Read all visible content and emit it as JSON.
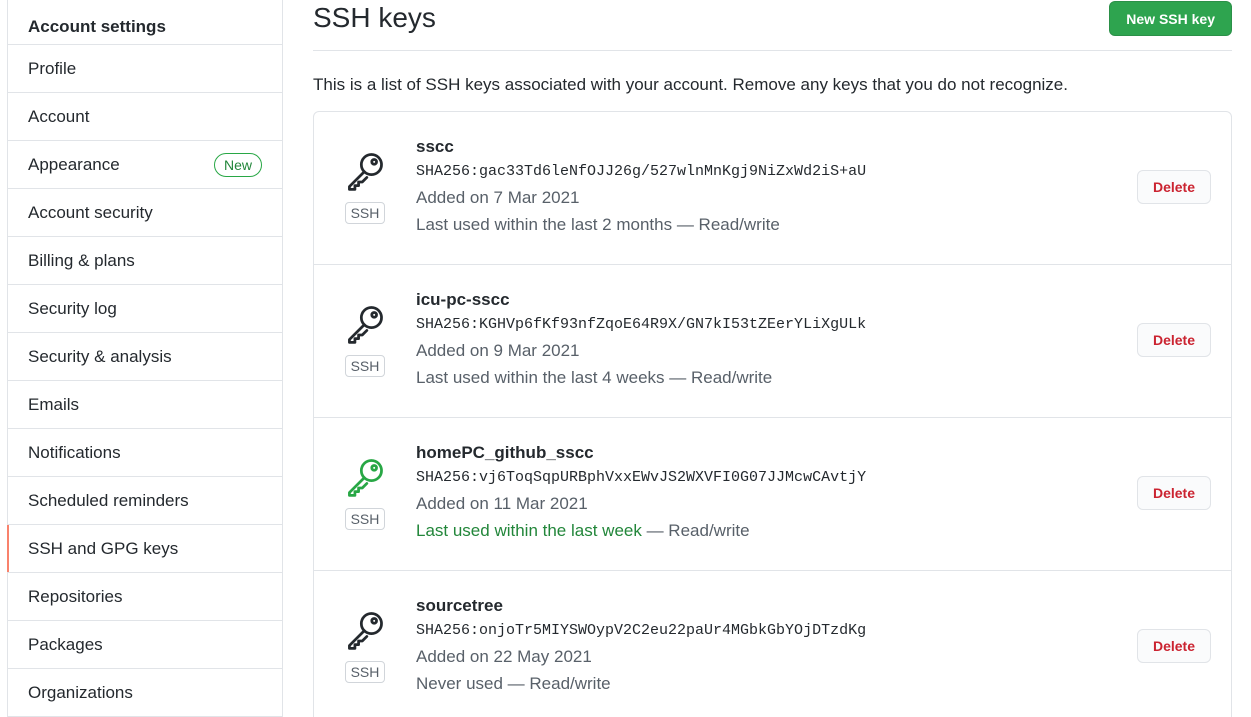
{
  "sidebar": {
    "header": "Account settings",
    "items": [
      {
        "label": "Profile"
      },
      {
        "label": "Account"
      },
      {
        "label": "Appearance",
        "badge": "New"
      },
      {
        "label": "Account security"
      },
      {
        "label": "Billing & plans"
      },
      {
        "label": "Security log"
      },
      {
        "label": "Security & analysis"
      },
      {
        "label": "Emails"
      },
      {
        "label": "Notifications"
      },
      {
        "label": "Scheduled reminders"
      },
      {
        "label": "SSH and GPG keys",
        "selected": true
      },
      {
        "label": "Repositories"
      },
      {
        "label": "Packages"
      },
      {
        "label": "Organizations"
      }
    ]
  },
  "main": {
    "title": "SSH keys",
    "new_key_label": "New SSH key",
    "intro": "This is a list of SSH keys associated with your account. Remove any keys that you do not recognize.",
    "keys": [
      {
        "name": "sscc",
        "fingerprint": "SHA256:gac33Td6leNfOJJ26g/527wlnMnKgj9NiZxWd2iS+aU",
        "added": "Added on 7 Mar 2021",
        "last_used": "Last used within the last 2 months",
        "access": " — Read/write",
        "recent": false,
        "type_label": "SSH",
        "delete_label": "Delete"
      },
      {
        "name": "icu-pc-sscc",
        "fingerprint": "SHA256:KGHVp6fKf93nfZqoE64R9X/GN7kI53tZEerYLiXgULk",
        "added": "Added on 9 Mar 2021",
        "last_used": "Last used within the last 4 weeks",
        "access": " — Read/write",
        "recent": false,
        "type_label": "SSH",
        "delete_label": "Delete"
      },
      {
        "name": "homePC_github_sscc",
        "fingerprint": "SHA256:vj6ToqSqpURBphVxxEWvJS2WXVFI0G07JJMcwCAvtjY",
        "added": "Added on 11 Mar 2021",
        "last_used": "Last used within the last week",
        "access": " — Read/write",
        "recent": true,
        "type_label": "SSH",
        "delete_label": "Delete"
      },
      {
        "name": "sourcetree",
        "fingerprint": "SHA256:onjoTr5MIYSWOypV2C2eu22paUr4MGbkGbYOjDTzdKg",
        "added": "Added on 22 May 2021",
        "last_used": "Never used",
        "access": " — Read/write",
        "recent": false,
        "type_label": "SSH",
        "delete_label": "Delete"
      }
    ]
  },
  "colors": {
    "primary_button": "#2ea44f",
    "danger_text": "#cb2431",
    "recent_green": "#22863a",
    "selected_marker": "#f9826c",
    "key_icon_default": "#24292e",
    "key_icon_recent": "#28a745"
  },
  "icons": {
    "key": "key-icon"
  }
}
